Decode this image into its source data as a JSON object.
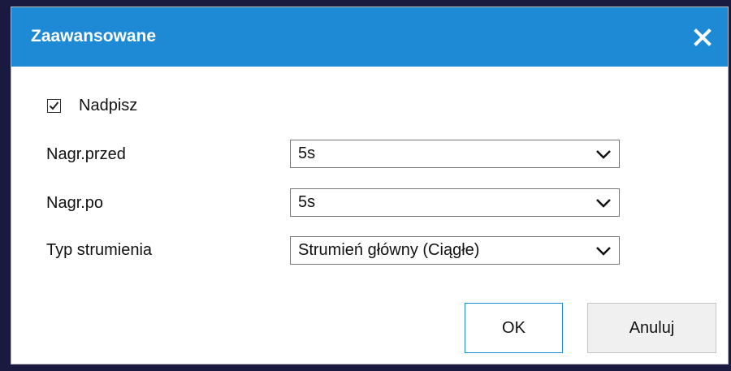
{
  "dialog": {
    "title": "Zaawansowane",
    "accent_color": "#1e8ad6",
    "close_icon": "close-icon"
  },
  "overwrite": {
    "label": "Nadpisz",
    "checked": true
  },
  "fields": {
    "pre_record": {
      "label": "Nagr.przed",
      "value": "5s"
    },
    "post_record": {
      "label": "Nagr.po",
      "value": "5s"
    },
    "stream_type": {
      "label": "Typ strumienia",
      "value": "Strumień główny (Ciągłe)"
    }
  },
  "buttons": {
    "ok_label": "OK",
    "cancel_label": "Anuluj"
  }
}
